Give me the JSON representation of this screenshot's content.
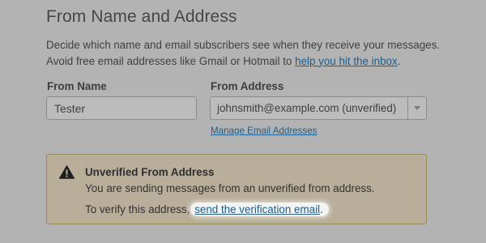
{
  "section": {
    "title": "From Name and Address",
    "description_line1": "Decide which name and email subscribers see when they receive your messages.",
    "description_line2_prefix": "Avoid free email addresses like Gmail or Hotmail to ",
    "description_link": "help you hit the inbox",
    "description_suffix": "."
  },
  "from_name": {
    "label": "From Name",
    "value": "Tester"
  },
  "from_address": {
    "label": "From Address",
    "selected": "johnsmith@example.com (unverified)",
    "manage_link": "Manage Email Addresses"
  },
  "warning": {
    "title": "Unverified From Address",
    "body": "You are sending messages from an unverified from address.",
    "verify_prefix": "To verify this address, ",
    "verify_link": "send the verification email",
    "verify_suffix": "."
  },
  "colors": {
    "background": "#b3b3b3",
    "link": "#1f5d8c",
    "warning_bg": "#b8ae9a",
    "warning_border": "#a0865a"
  },
  "icons": {
    "warning": "warning-triangle-icon",
    "dropdown": "chevron-down-icon"
  }
}
